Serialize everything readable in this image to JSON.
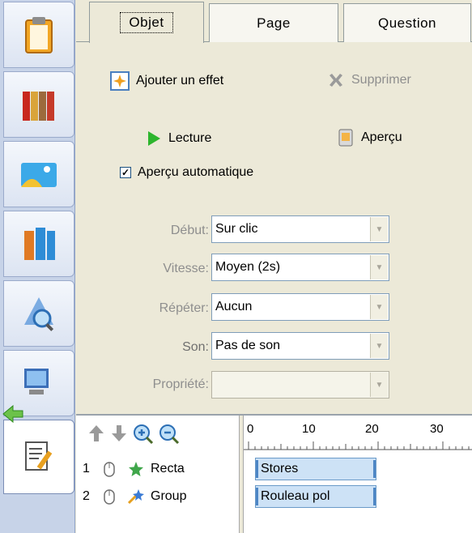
{
  "tabs": [
    "Objet",
    "Page",
    "Question"
  ],
  "actions": {
    "add_effect": "Ajouter un effet",
    "delete": "Supprimer",
    "play": "Lecture",
    "preview": "Aperçu",
    "auto_preview": "Aperçu automatique",
    "auto_preview_checked": true
  },
  "fields": [
    {
      "label": "Début:",
      "value": "Sur clic"
    },
    {
      "label": "Vitesse:",
      "value": "Moyen (2s)"
    },
    {
      "label": "Répéter:",
      "value": "Aucun"
    },
    {
      "label": "Son:",
      "value": "Pas de son"
    },
    {
      "label": "Propriété:",
      "value": ""
    }
  ],
  "effects_list": [
    {
      "num": "1",
      "name": "Recta"
    },
    {
      "num": "2",
      "name": "Group"
    }
  ],
  "timeline": {
    "ruler": [
      "0",
      "10",
      "20",
      "30"
    ],
    "bars": [
      "Stores",
      "Rouleau pol"
    ]
  },
  "sidebar_icons": [
    "clipboard-icon",
    "books-icon",
    "picture-icon",
    "binders-icon",
    "search-globe-icon",
    "computer-icon",
    "edit-document-icon"
  ]
}
